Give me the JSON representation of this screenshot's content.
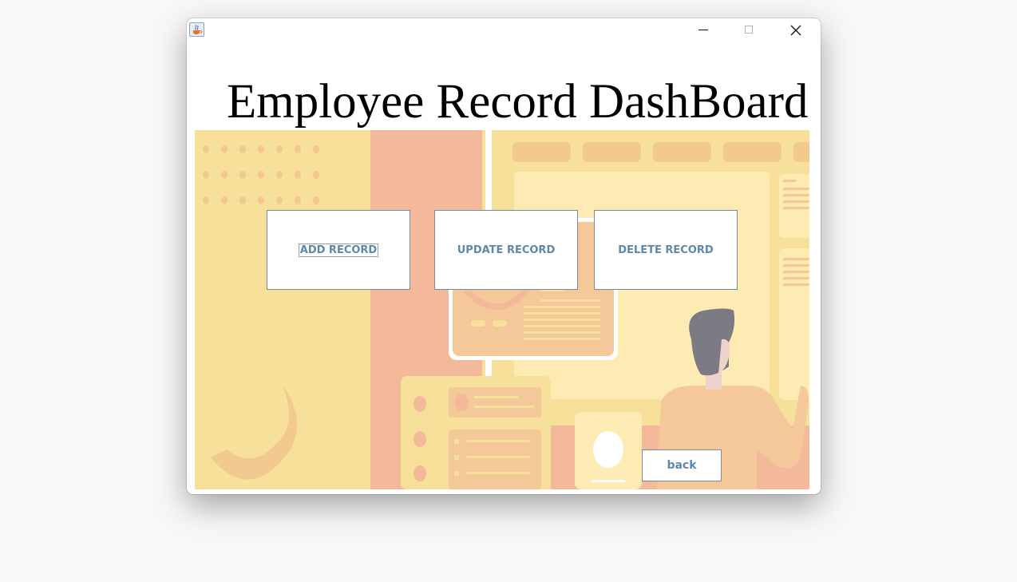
{
  "window": {
    "title_icon": "java-coffee-icon",
    "controls": {
      "minimize_icon": "minimize-icon",
      "maximize_icon": "maximize-icon",
      "close_icon": "close-icon"
    }
  },
  "dashboard": {
    "heading": "Employee Record DashBoard",
    "buttons": {
      "add": "ADD RECORD",
      "update": "UPDATE RECORD",
      "delete": "DELETE RECORD",
      "back": "back"
    },
    "accent_color": "#5d88aa",
    "background_colors": {
      "yellow": "#f7e09a",
      "salmon": "#f4b99a",
      "light_yellow": "#fdebb3"
    }
  }
}
